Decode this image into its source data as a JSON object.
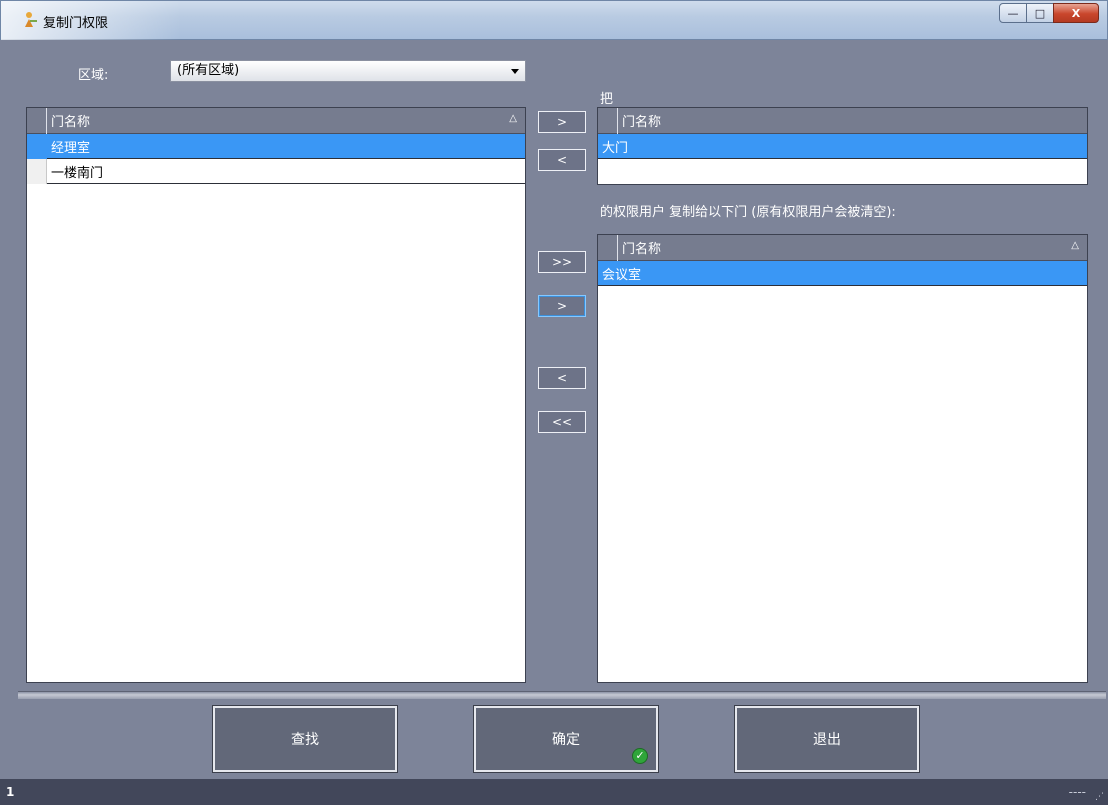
{
  "window": {
    "title": "复制门权限",
    "minimize_symbol": "—",
    "maximize_symbol": "□",
    "close_symbol": "X"
  },
  "filter": {
    "region_label": "区域:",
    "region_value": "(所有区域)"
  },
  "left_grid": {
    "header": "门名称",
    "sort_symbol": "△",
    "rows": [
      "经理室",
      "一楼南门"
    ]
  },
  "source_label": "把",
  "source_grid": {
    "header": "门名称",
    "rows": [
      "大门"
    ]
  },
  "target_label": "的权限用户 复制给以下门 (原有权限用户会被清空):",
  "target_grid": {
    "header": "门名称",
    "sort_symbol": "△",
    "rows": [
      "会议室"
    ]
  },
  "transfer_buttons": {
    "source_add": ">",
    "source_remove": "<",
    "target_add_all": ">>",
    "target_add": ">",
    "target_remove": "<",
    "target_remove_all": "<<"
  },
  "actions": {
    "find": "查找",
    "confirm": "确定",
    "exit": "退出"
  },
  "status": {
    "left": "1",
    "right": "----"
  },
  "icons": {
    "app": "key-person-icon",
    "confirm_badge": "check-circle-icon"
  },
  "colors": {
    "background": "#7d8499",
    "selection": "#3a97f5",
    "button": "#626879"
  }
}
